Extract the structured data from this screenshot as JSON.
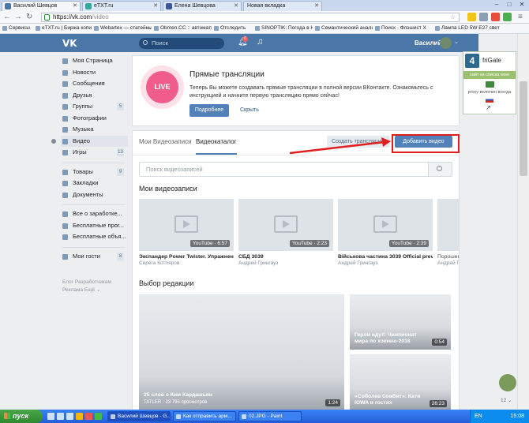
{
  "browser": {
    "tabs": [
      {
        "label": "Василий Шевцов",
        "active": true
      },
      {
        "label": "eTXT.ru",
        "active": false
      },
      {
        "label": "Елена Шевцова",
        "active": false
      },
      {
        "label": "Новая вкладка",
        "active": false
      }
    ],
    "url_host": "https://vk.com",
    "url_path": "/video",
    "window_buttons": [
      "‒",
      "□",
      "✕"
    ],
    "bookmarks": [
      "Сервисы",
      "eTXT.ru | Биржа копир...",
      "Webartex — статейны...",
      "Obmen.CC :: автомати...",
      "Отследить",
      "SINOPTIK: Погода в Н...",
      "Семантический анали...",
      "Поиск · Флэшист Х",
      "Лампа LED 5W E27 свет"
    ]
  },
  "vk": {
    "logo": "VK",
    "search_placeholder": "Поиск",
    "notification_count": "6",
    "user_name": "Василий",
    "sidebar": {
      "items": [
        {
          "label": "Моя Страница",
          "count": ""
        },
        {
          "label": "Новости",
          "count": ""
        },
        {
          "label": "Сообщения",
          "count": ""
        },
        {
          "label": "Друзья",
          "count": ""
        },
        {
          "label": "Группы",
          "count": "5"
        },
        {
          "label": "Фотографии",
          "count": ""
        },
        {
          "label": "Музыка",
          "count": ""
        },
        {
          "label": "Видео",
          "count": "",
          "active": true
        },
        {
          "label": "Игры",
          "count": "13"
        }
      ],
      "items2": [
        {
          "label": "Товары",
          "count": "9"
        },
        {
          "label": "Закладки",
          "count": ""
        },
        {
          "label": "Документы",
          "count": ""
        }
      ],
      "items3": [
        {
          "label": "Все о заработке...",
          "count": ""
        },
        {
          "label": "Бесплатные прог...",
          "count": ""
        },
        {
          "label": "Бесплатные объя...",
          "count": ""
        }
      ],
      "items4": [
        {
          "label": "Мои гости",
          "count": "8"
        }
      ],
      "footer_line1": "Блог   Разработчикам",
      "footer_line2": "Реклама   Ещё ⌄"
    },
    "live": {
      "badge": "LIVE",
      "title": "Прямые трансляции",
      "text": "Теперь Вы можете создавать прямые трансляции в полной версии ВКонтакте. Ознакомьтесь с инструкцией и начните первую трансляцию прямо сейчас!",
      "more_button": "Подробнее",
      "close_button": "Скрыть"
    },
    "video": {
      "tabs": [
        "Мои Видеозаписи",
        "Видеокаталог"
      ],
      "create_button": "Создать трансляцию",
      "add_button": "Добавить видео",
      "search_placeholder": "Поиск видеозаписей",
      "my_videos_title": "Мои видеозаписи",
      "my_videos": [
        {
          "duration": "YouTube · 6:57",
          "title": "Экспандер Power Twister. Упражнен...",
          "author": "Серёга Котляров"
        },
        {
          "duration": "YouTube · 2:23",
          "title": "СБД 3039",
          "author": "Андрей Грингауз"
        },
        {
          "duration": "YouTube · 2:39",
          "title": "Військова частина 3039 Official previ...",
          "author": "Андрей Грингауз"
        },
        {
          "duration": "",
          "title": "Порошен...",
          "author": "Андрей Гр..."
        }
      ],
      "editors_title": "Выбор редакции",
      "editors": [
        {
          "title": "25 слов о Ким Кардашьян",
          "sub": "TATLER · 23 796 просмотров",
          "duration": "1:24"
        },
        {
          "title": "Герои идут! Чемпионат мира по хоккею-2018",
          "sub": "",
          "duration": "0:54"
        },
        {
          "title": "«Соболев бомбит»: Катя IOWA в гостях",
          "sub": "",
          "duration": "26:23"
        }
      ]
    }
  },
  "frigate": {
    "name": "friGate",
    "logo": "4",
    "list_label": "сайт из списка wow",
    "proxy_label": "proxy включен всегда",
    "arrow": "↗"
  },
  "right_widget": {
    "count": "12 ⌄"
  },
  "taskbar": {
    "start_label": "пуск",
    "tasks": [
      "Василий Шевцов - G...",
      "Как отправить арм...",
      "02.JPG - Paint"
    ],
    "lang": "EN",
    "clock": "15:08"
  },
  "colors": {
    "vk_blue": "#4a76a8",
    "button_blue": "#5181b8",
    "live_pink": "#f15d8a",
    "highlight_red": "#e01e1e"
  }
}
